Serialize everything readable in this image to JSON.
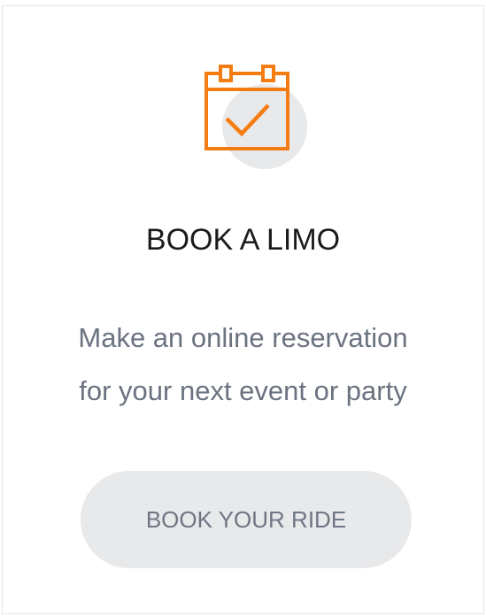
{
  "card": {
    "icon": "calendar-check-icon",
    "title": "BOOK A LIMO",
    "description_line1": "Make an online reservation",
    "description_line2": "for your next event or party",
    "button_label": "BOOK YOUR RIDE"
  },
  "colors": {
    "accent": "#f57c12",
    "icon_circle": "#e8e9eb",
    "title_text": "#1b1b1b",
    "body_text": "#6b7280",
    "button_bg": "#e8e9eb",
    "button_text": "#6f7683"
  }
}
